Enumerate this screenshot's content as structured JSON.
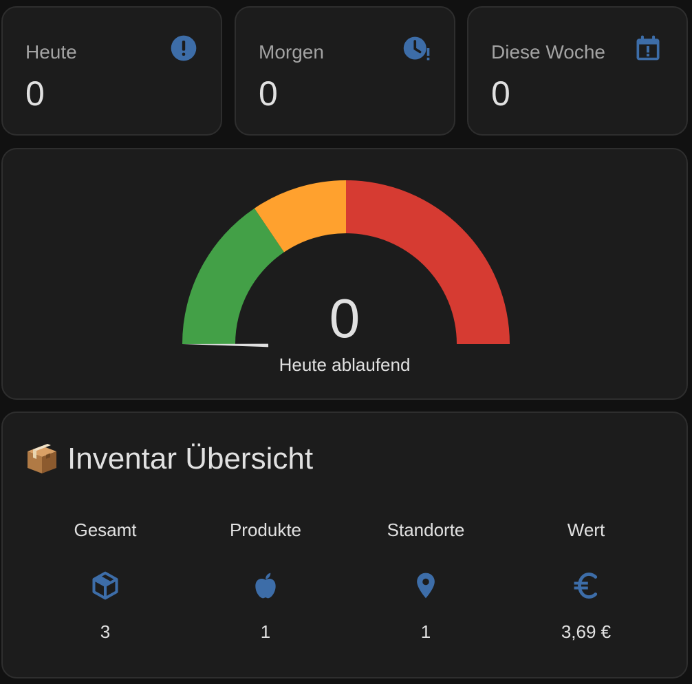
{
  "colors": {
    "accent_icon": "#3d6da8",
    "gauge_green": "#43a047",
    "gauge_orange": "#ffa12e",
    "gauge_red": "#d63b32",
    "gauge_needle": "#e0e0e0"
  },
  "stats": [
    {
      "label": "Heute",
      "value": "0",
      "icon": "alert-circle-icon"
    },
    {
      "label": "Morgen",
      "value": "0",
      "icon": "clock-alert-icon"
    },
    {
      "label": "Diese Woche",
      "value": "0",
      "icon": "calendar-alert-icon"
    }
  ],
  "gauge": {
    "value": "0",
    "label": "Heute ablaufend",
    "level": 0
  },
  "inventory": {
    "title_icon": "package-emoji",
    "title": "Inventar Übersicht",
    "columns": [
      {
        "label": "Gesamt",
        "icon": "cube-icon",
        "value": "3"
      },
      {
        "label": "Produkte",
        "icon": "apple-icon",
        "value": "1"
      },
      {
        "label": "Standorte",
        "icon": "map-marker-icon",
        "value": "1"
      },
      {
        "label": "Wert",
        "icon": "euro-icon",
        "value": "3,69 €"
      }
    ]
  }
}
